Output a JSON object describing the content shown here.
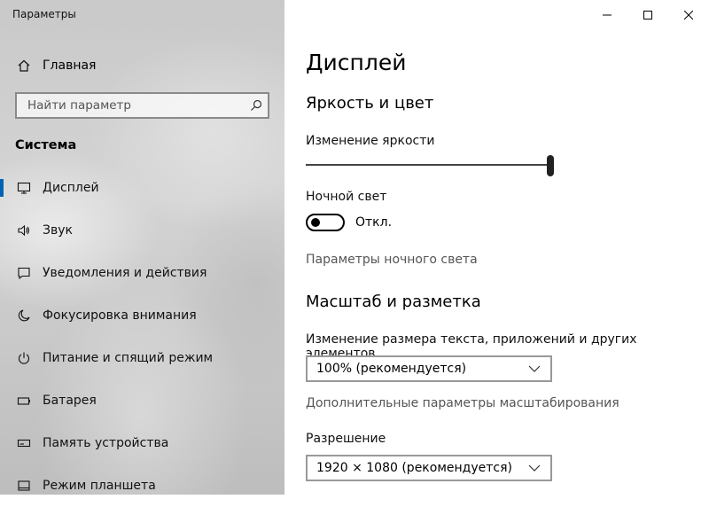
{
  "window": {
    "title": "Параметры"
  },
  "sidebar": {
    "home_label": "Главная",
    "search_placeholder": "Найти параметр",
    "section_title": "Система",
    "items": [
      {
        "label": "Дисплей",
        "icon": "monitor-icon",
        "active": true
      },
      {
        "label": "Звук",
        "icon": "speaker-icon"
      },
      {
        "label": "Уведомления и действия",
        "icon": "notification-icon"
      },
      {
        "label": "Фокусировка внимания",
        "icon": "moon-icon"
      },
      {
        "label": "Питание и спящий режим",
        "icon": "power-icon"
      },
      {
        "label": "Батарея",
        "icon": "battery-icon"
      },
      {
        "label": "Память устройства",
        "icon": "storage-icon"
      },
      {
        "label": "Режим планшета",
        "icon": "tablet-icon"
      }
    ]
  },
  "main": {
    "title": "Дисплей",
    "brightness_section": "Яркость и цвет",
    "brightness_label": "Изменение яркости",
    "brightness_value": 100,
    "night_light_label": "Ночной свет",
    "night_light_state": "Откл.",
    "night_light_settings_link": "Параметры ночного света",
    "scale_section": "Масштаб и разметка",
    "scale_label": "Изменение размера текста, приложений и других элементов",
    "scale_value": "100% (рекомендуется)",
    "advanced_scaling_link": "Дополнительные параметры масштабирования",
    "resolution_label": "Разрешение",
    "resolution_value": "1920 × 1080 (рекомендуется)"
  },
  "colors": {
    "accent": "#0063b1"
  }
}
